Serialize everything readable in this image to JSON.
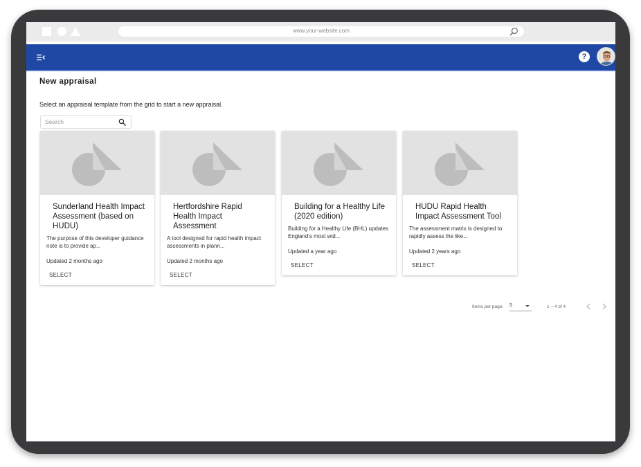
{
  "browser": {
    "url": "www.your-website.com"
  },
  "page": {
    "title": "New appraisal",
    "instructions": "Select an appraisal template from the grid to start a new appraisal.",
    "search_placeholder": "Search"
  },
  "cards": [
    {
      "title": "Sunderland Health Impact Assessment (based on HUDU)",
      "description": "The purpose of this developer guidance note is to provide ap...",
      "updated": "Updated 2 months ago",
      "action": "SELECT"
    },
    {
      "title": "Hertfordshire Rapid Health Impact Assessment",
      "description": "A tool designed for rapid health impact assessments in plann...",
      "updated": "Updated 2 months ago",
      "action": "SELECT"
    },
    {
      "title": "Building for a Healthy Life (2020 edition)",
      "description": "Building for a Healthy Life (BHL) updates England's most wid...",
      "updated": "Updated a year ago",
      "action": "SELECT"
    },
    {
      "title": "HUDU Rapid Health Impact Assessment Tool",
      "description": "The assessment matrix is designed to rapidly assess the like...",
      "updated": "Updated 2 years ago",
      "action": "SELECT"
    }
  ],
  "pagination": {
    "items_per_page_label": "Items per page:",
    "items_per_page_value": "5",
    "range": "1 – 4 of 4"
  },
  "icons": {
    "menu": "menu-collapse-icon",
    "help": "help-icon",
    "search": "search-icon",
    "prev": "chevron-left-icon",
    "next": "chevron-right-icon",
    "placeholder": "image-placeholder-icon"
  },
  "colors": {
    "app_bar": "#1e48a4",
    "card_media": "#e2e2e2",
    "placeholder_shape": "#bdbdbd",
    "device_frame": "#3a3a3c"
  }
}
